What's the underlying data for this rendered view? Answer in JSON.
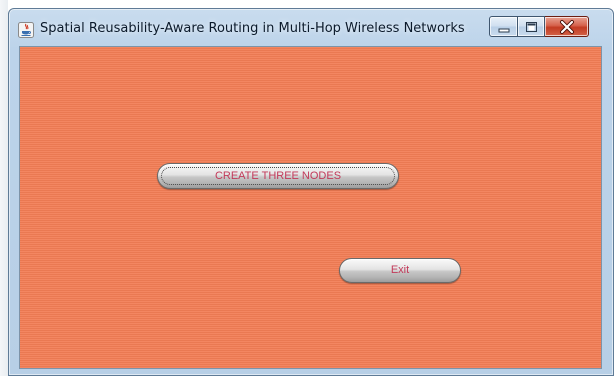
{
  "window": {
    "title": "Spatial Reusability-Aware Routing in Multi-Hop Wireless Networks",
    "app_icon": "java-icon",
    "controls": {
      "minimize_icon": "minimize-icon",
      "maximize_icon": "maximize-icon",
      "close_icon": "close-icon"
    }
  },
  "content": {
    "background_color": "#f27d55",
    "buttons": {
      "create_nodes_label": "CREATE THREE NODES",
      "exit_label": "Exit",
      "label_color": "#c23a5a"
    }
  }
}
